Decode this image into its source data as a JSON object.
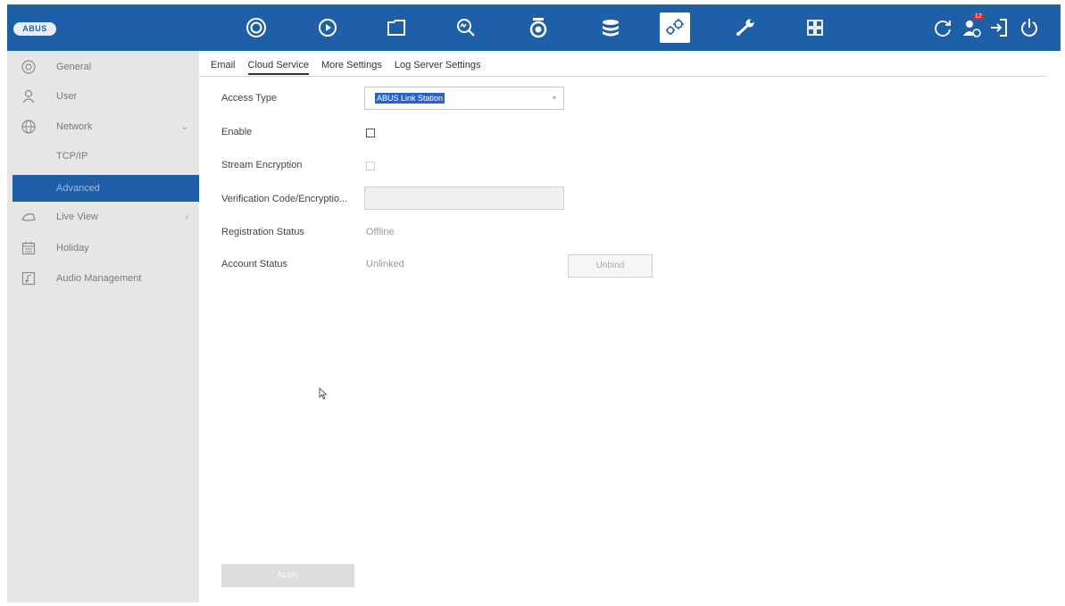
{
  "topbar": {
    "logo": "ABUS",
    "icons": [
      "live-view-icon",
      "playback-icon",
      "file-management-icon",
      "smart-analysis-icon",
      "camera-icon",
      "storage-icon",
      "configuration-icon",
      "maintenance-icon",
      "layout-icon"
    ],
    "right_icons": [
      "refresh-icon",
      "alarm-user-icon",
      "logout-icon",
      "power-icon"
    ],
    "badge": "12",
    "accent": "#1f5fa8"
  },
  "sidebar": {
    "items": [
      {
        "label": "General",
        "icon": "general-icon"
      },
      {
        "label": "User",
        "icon": "user-icon"
      },
      {
        "label": "Network",
        "icon": "network-icon",
        "chevron": "⌄"
      },
      {
        "label": "TCP/IP"
      },
      {
        "label": "Advanced"
      },
      {
        "label": "Live View",
        "icon": "live-view-icon",
        "chevron": "›"
      },
      {
        "label": "Holiday",
        "icon": "calendar-icon"
      },
      {
        "label": "Audio Management",
        "icon": "audio-icon"
      }
    ],
    "selected_color": "#1f5fa8"
  },
  "tabs": [
    "Email",
    "Cloud Service",
    "More Settings",
    "Log Server Settings"
  ],
  "form": {
    "access_type_label": "Access Type",
    "access_type_value": "ABUS Link Station",
    "enable_label": "Enable",
    "stream_encryption_label": "Stream Encryption",
    "verification_label": "Verification Code/Encryptio...",
    "registration_status_label": "Registration Status",
    "registration_status_value": "Offline",
    "account_status_label": "Account Status",
    "account_status_value": "Unlinked",
    "unbind_button": "Unbind",
    "apply_button": "Apply"
  }
}
